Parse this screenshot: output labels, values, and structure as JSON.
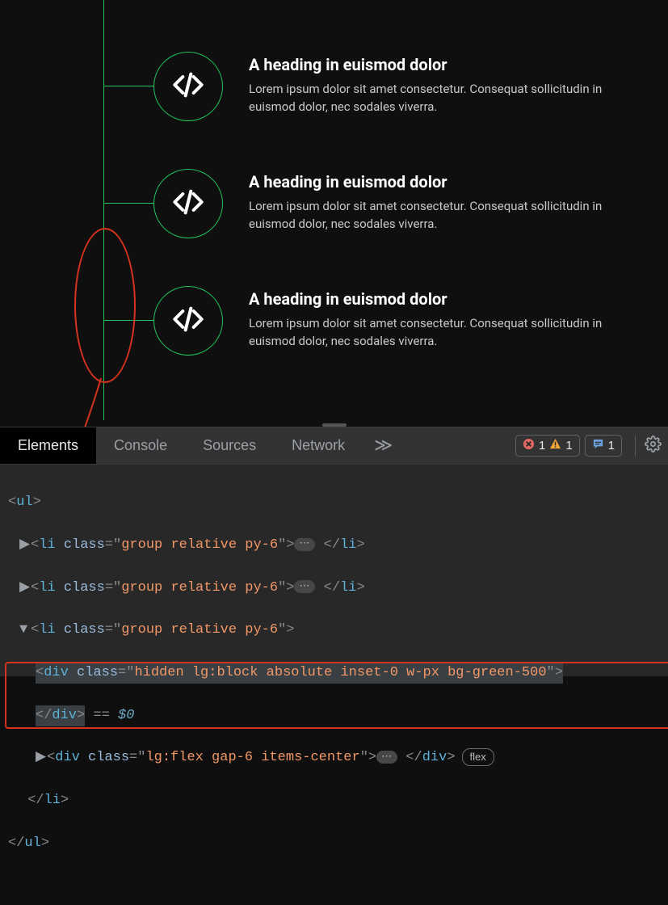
{
  "preview": {
    "items": [
      {
        "heading": "A heading in euismod dolor",
        "body": "Lorem ipsum dolor sit amet consectetur. Consequat sollicitudin in euismod dolor, nec sodales viverra."
      },
      {
        "heading": "A heading in euismod dolor",
        "body": "Lorem ipsum dolor sit amet consectetur. Consequat sollicitudin in euismod dolor, nec sodales viverra."
      },
      {
        "heading": "A heading in euismod dolor",
        "body": "Lorem ipsum dolor sit amet consectetur. Consequat sollicitudin in euismod dolor, nec sodales viverra."
      }
    ]
  },
  "devtools": {
    "tabs": {
      "elements": "Elements",
      "console": "Console",
      "sources": "Sources",
      "network": "Network"
    },
    "more_glyph": "≫",
    "badges": {
      "error_count": "1",
      "warn_count": "1",
      "msg_count": "1"
    },
    "dom": {
      "ul_open": "<ul>",
      "li1_open": "<li ",
      "li_attr": "class",
      "li_val": "group relative py-6",
      "li1_close_a": ">",
      "li1_close_b": "</li>",
      "li3_div1_open": "<div ",
      "li3_div1_attr": "class",
      "li3_div1_val": "hidden lg:block absolute inset-0 w-px bg-green-500",
      "li3_div1_close_a": ">",
      "li3_div1_close_b": "</div>",
      "eq": " == ",
      "dollar": "$0",
      "li3_div2_open": "<div ",
      "li3_div2_attr": "class",
      "li3_div2_val": "lg:flex gap-6 items-center",
      "li3_div2_close_a": ">",
      "li3_div2_close_b": "</div>",
      "pill": "flex",
      "li_close": "</li>",
      "ul_close": "</ul>",
      "ellipsis": "⋯"
    }
  }
}
